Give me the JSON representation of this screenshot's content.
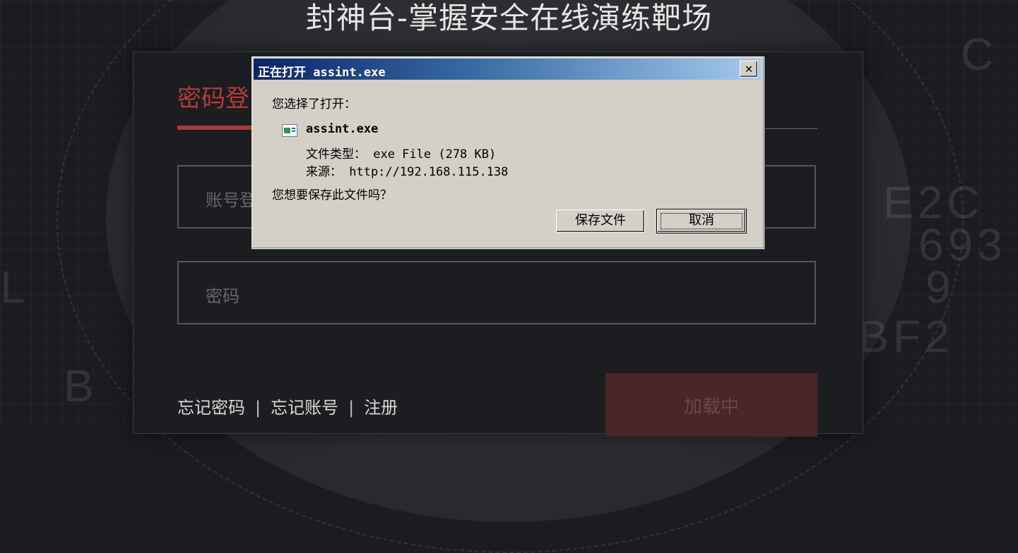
{
  "page": {
    "title": "封神台-掌握安全在线演练靶场",
    "bg_decor": [
      "E2C",
      "693",
      "9",
      "BF2",
      "B",
      "L",
      "C"
    ]
  },
  "login": {
    "tab_label": "密码登",
    "account_placeholder": "账号登",
    "password_placeholder": "密码",
    "links": {
      "forgot_password": "忘记密码",
      "separator": "|",
      "forgot_account": "忘记账号",
      "register": "注册"
    },
    "load_button": "加载中"
  },
  "dialog": {
    "title": "正在打开 assint.exe",
    "prompt": "您选择了打开：",
    "file_name": "assint.exe",
    "file_type": "文件类型： exe File (278 KB)",
    "source": "来源： http://192.168.115.138",
    "question": "您想要保存此文件吗？",
    "save_button": "保存文件",
    "cancel_button": "取消",
    "close_symbol": "✕"
  },
  "colors": {
    "accent_red": "#b53b3b",
    "titlebar_start": "#0a246a",
    "titlebar_end": "#a6caf0",
    "dialog_bg": "#d4d0c8"
  }
}
